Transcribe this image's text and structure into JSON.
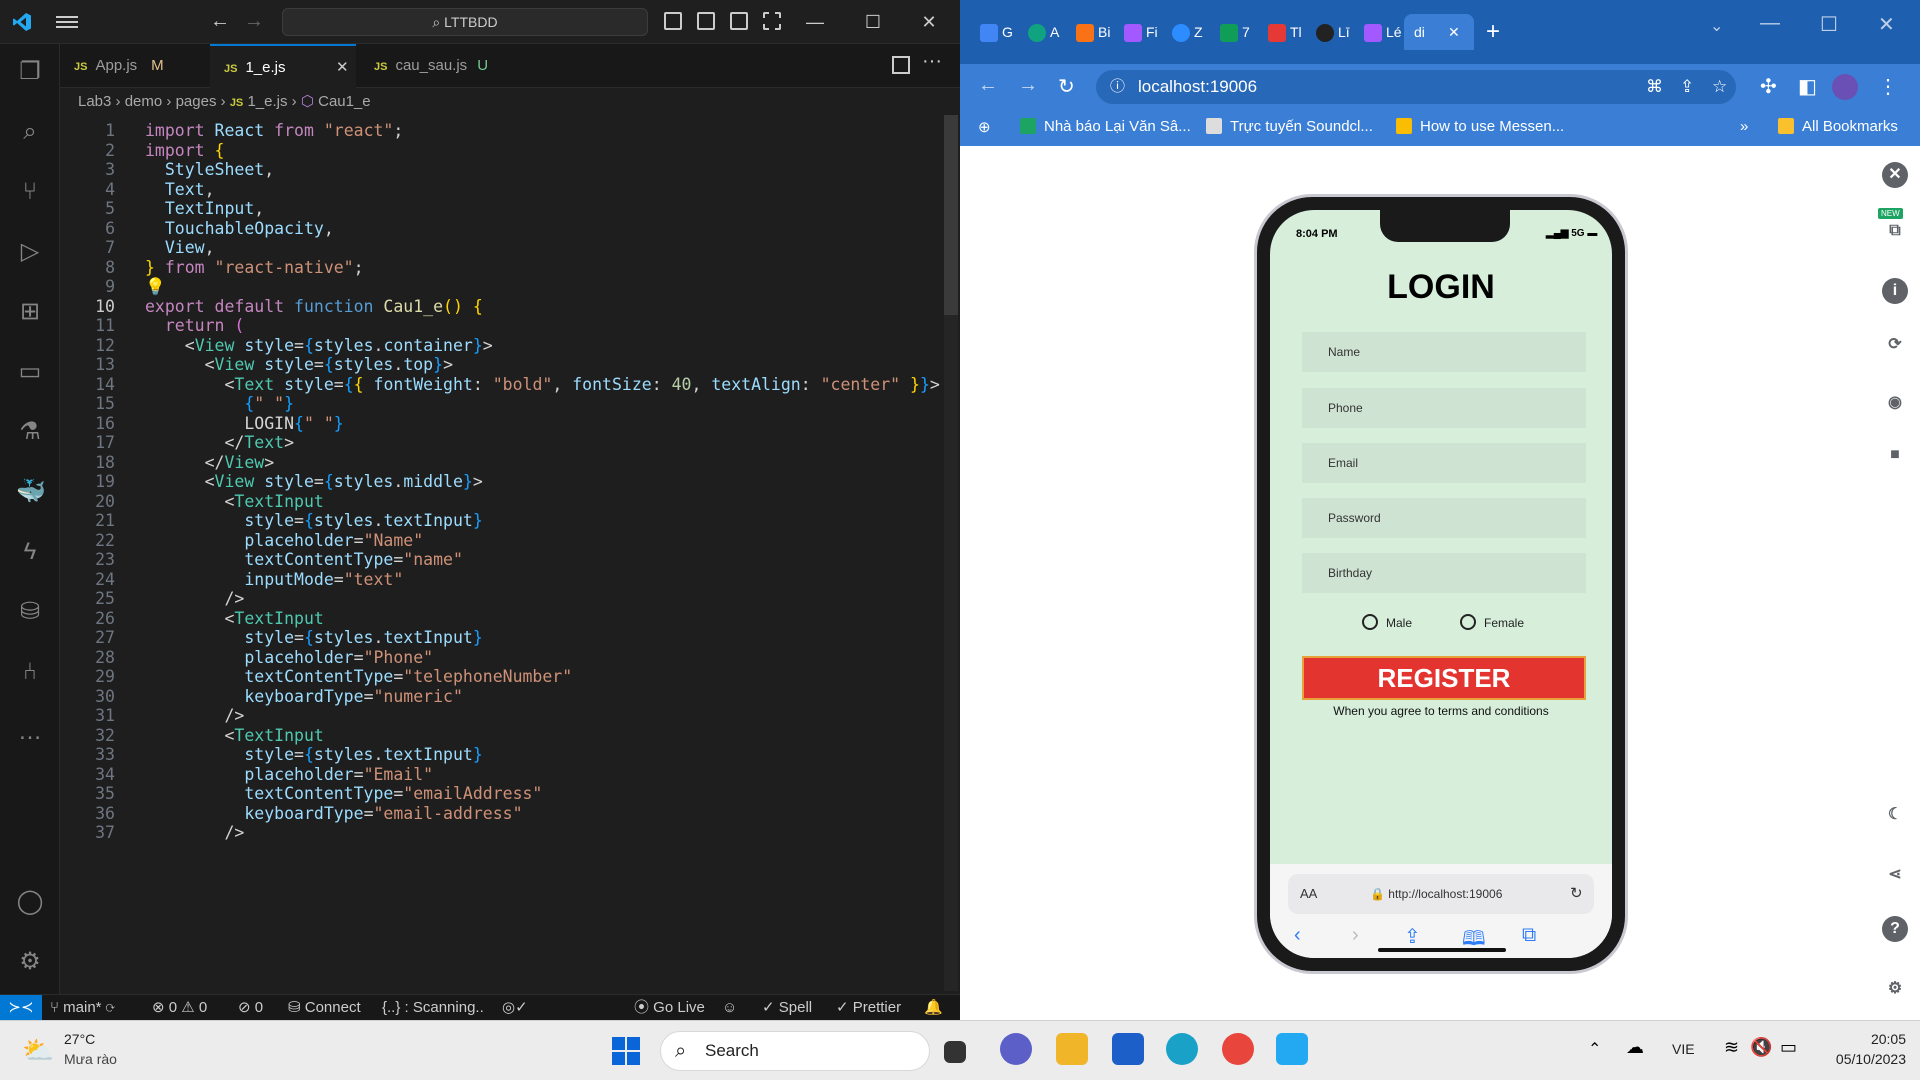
{
  "vscode": {
    "search": "LTTBDD",
    "tabs": [
      {
        "label": "App.js",
        "badge": "M"
      },
      {
        "label": "1_e.js",
        "badge": ""
      },
      {
        "label": "cau_sau.js",
        "badge": "U"
      }
    ],
    "breadcrumb": [
      "Lab3",
      "demo",
      "pages",
      "1_e.js",
      "Cau1_e"
    ],
    "status": {
      "branch": "main*",
      "errors": "0",
      "warnings": "0",
      "ports": "0",
      "connect": "Connect",
      "scanning": "{..} : Scanning..",
      "go_live": "Go Live",
      "spell": "Spell",
      "prettier": "Prettier"
    }
  },
  "chrome": {
    "tab_letters": [
      "G",
      "A",
      "Bi",
      "Fi",
      "Z",
      "7",
      "Tl",
      "Lī",
      "Lé",
      "di"
    ],
    "url": "localhost:19006",
    "bookmarks": [
      "Nhà báo Lại Văn Sâ...",
      "Trực tuyến Soundcl...",
      "How to use Messen...",
      "All Bookmarks"
    ],
    "phone": {
      "time": "8:04 PM",
      "network": "5G",
      "title": "LOGIN",
      "fields": [
        "Name",
        "Phone",
        "Email",
        "Password",
        "Birthday"
      ],
      "radio_male": "Male",
      "radio_female": "Female",
      "register": "REGISTER",
      "terms": "When you agree to terms and conditions",
      "safari_aa": "AA",
      "safari_url": "http://localhost:19006"
    },
    "side_new_badge": "NEW"
  },
  "taskbar": {
    "temp": "27°C",
    "weather": "Mưa rào",
    "search": "Search",
    "lang": "VIE",
    "time": "20:05",
    "date": "05/10/2023"
  }
}
